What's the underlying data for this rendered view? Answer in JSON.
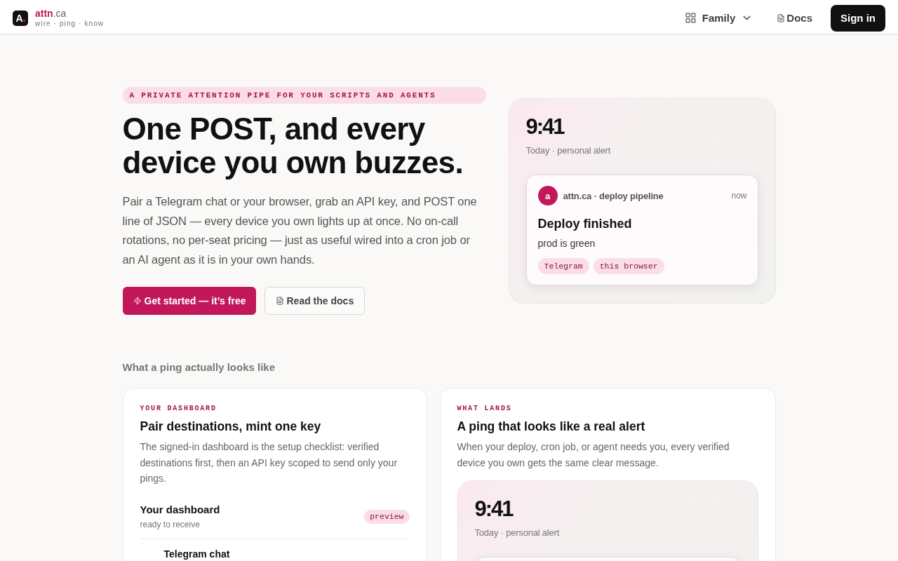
{
  "header": {
    "logo": {
      "mark": "A",
      "name": "attn",
      "domain": ".ca",
      "tagline": "wire · ping · know"
    },
    "nav": [
      {
        "kind": "menu",
        "label": "Family"
      },
      {
        "kind": "link",
        "label": "Docs"
      }
    ],
    "sign_in": "Sign in"
  },
  "hero": {
    "eyebrow": "A PRIVATE ATTENTION PIPE FOR YOUR SCRIPTS AND AGENTS",
    "title": "One POST, and every device you own buzzes.",
    "lead": "Pair a Telegram chat or your browser, grab an API key, and POST one line of JSON — every device you own lights up at once. No on-call rotations, no per-seat pricing — just as useful wired into a cron job or an AI agent as it is in your own hands.",
    "actions": [
      {
        "kind": "primary",
        "label": "Get started — it’s free"
      },
      {
        "kind": "secondary",
        "label": "Read the docs"
      }
    ],
    "preview": {
      "time": "9:41",
      "subtitle": "Today · personal alert",
      "notification": {
        "avatar": "a",
        "source": "attn.ca · deploy pipeline",
        "when": "now",
        "title": "Deploy finished",
        "body": "prod is green",
        "channels": [
          "Telegram",
          "this browser"
        ]
      }
    }
  },
  "section_label": "What a ping actually looks like",
  "cards": [
    {
      "kind": "dashboard",
      "eyebrow": "YOUR DASHBOARD",
      "title": "Pair destinations, mint one key",
      "text": "The signed-in dashboard is the setup checklist: verified destinations first, then an API key scoped to send only your pings.",
      "dashboard": {
        "title": "Your dashboard",
        "status": "ready to receive",
        "badge": "preview",
        "destinations": [
          "Telegram chat"
        ]
      }
    },
    {
      "kind": "lockscreen",
      "eyebrow": "WHAT LANDS",
      "title": "A ping that looks like a real alert",
      "text": "When your deploy, cron job, or agent needs you, every verified device you own gets the same clear message.",
      "preview": {
        "time": "9:41",
        "subtitle": "Today · personal alert"
      }
    }
  ]
}
